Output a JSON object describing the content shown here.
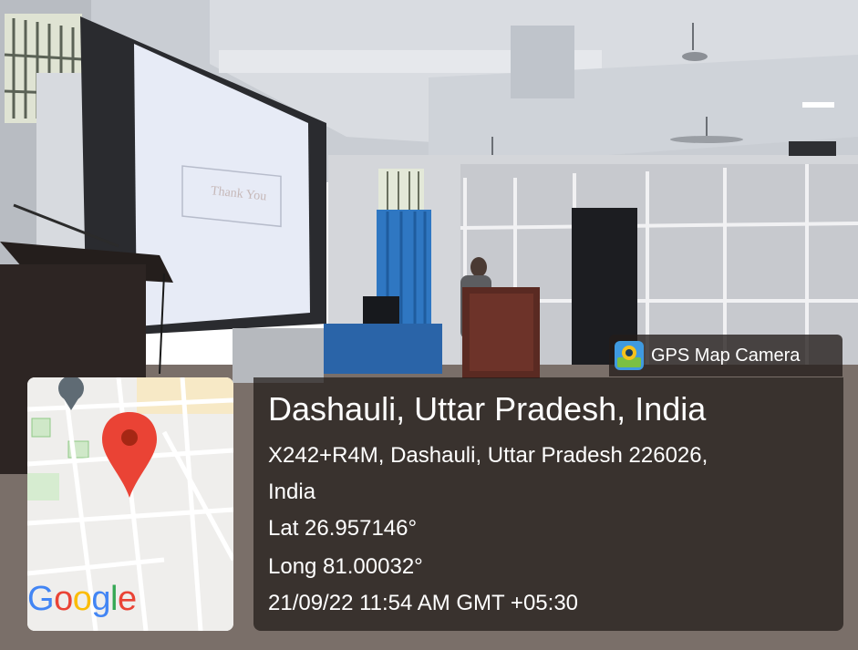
{
  "slide": {
    "text": "Thank You"
  },
  "app_badge": {
    "label": "GPS Map Camera",
    "icon": "gps-map-camera-app-icon"
  },
  "map": {
    "brand": "Google",
    "icon": "location-pin-icon"
  },
  "location": {
    "title": "Dashauli, Uttar Pradesh, India",
    "address_line1": "X242+R4M, Dashauli, Uttar Pradesh 226026,",
    "address_line2": "India",
    "latitude": "Lat 26.957146°",
    "longitude": "Long 81.00032°",
    "timestamp": "21/09/22 11:54 AM GMT +05:30"
  },
  "colors": {
    "overlay": "#231c19",
    "pin": "#ea4335",
    "google_blue": "#4285f4",
    "google_red": "#ea4335",
    "google_yellow": "#fbbc05",
    "google_green": "#34a853"
  }
}
